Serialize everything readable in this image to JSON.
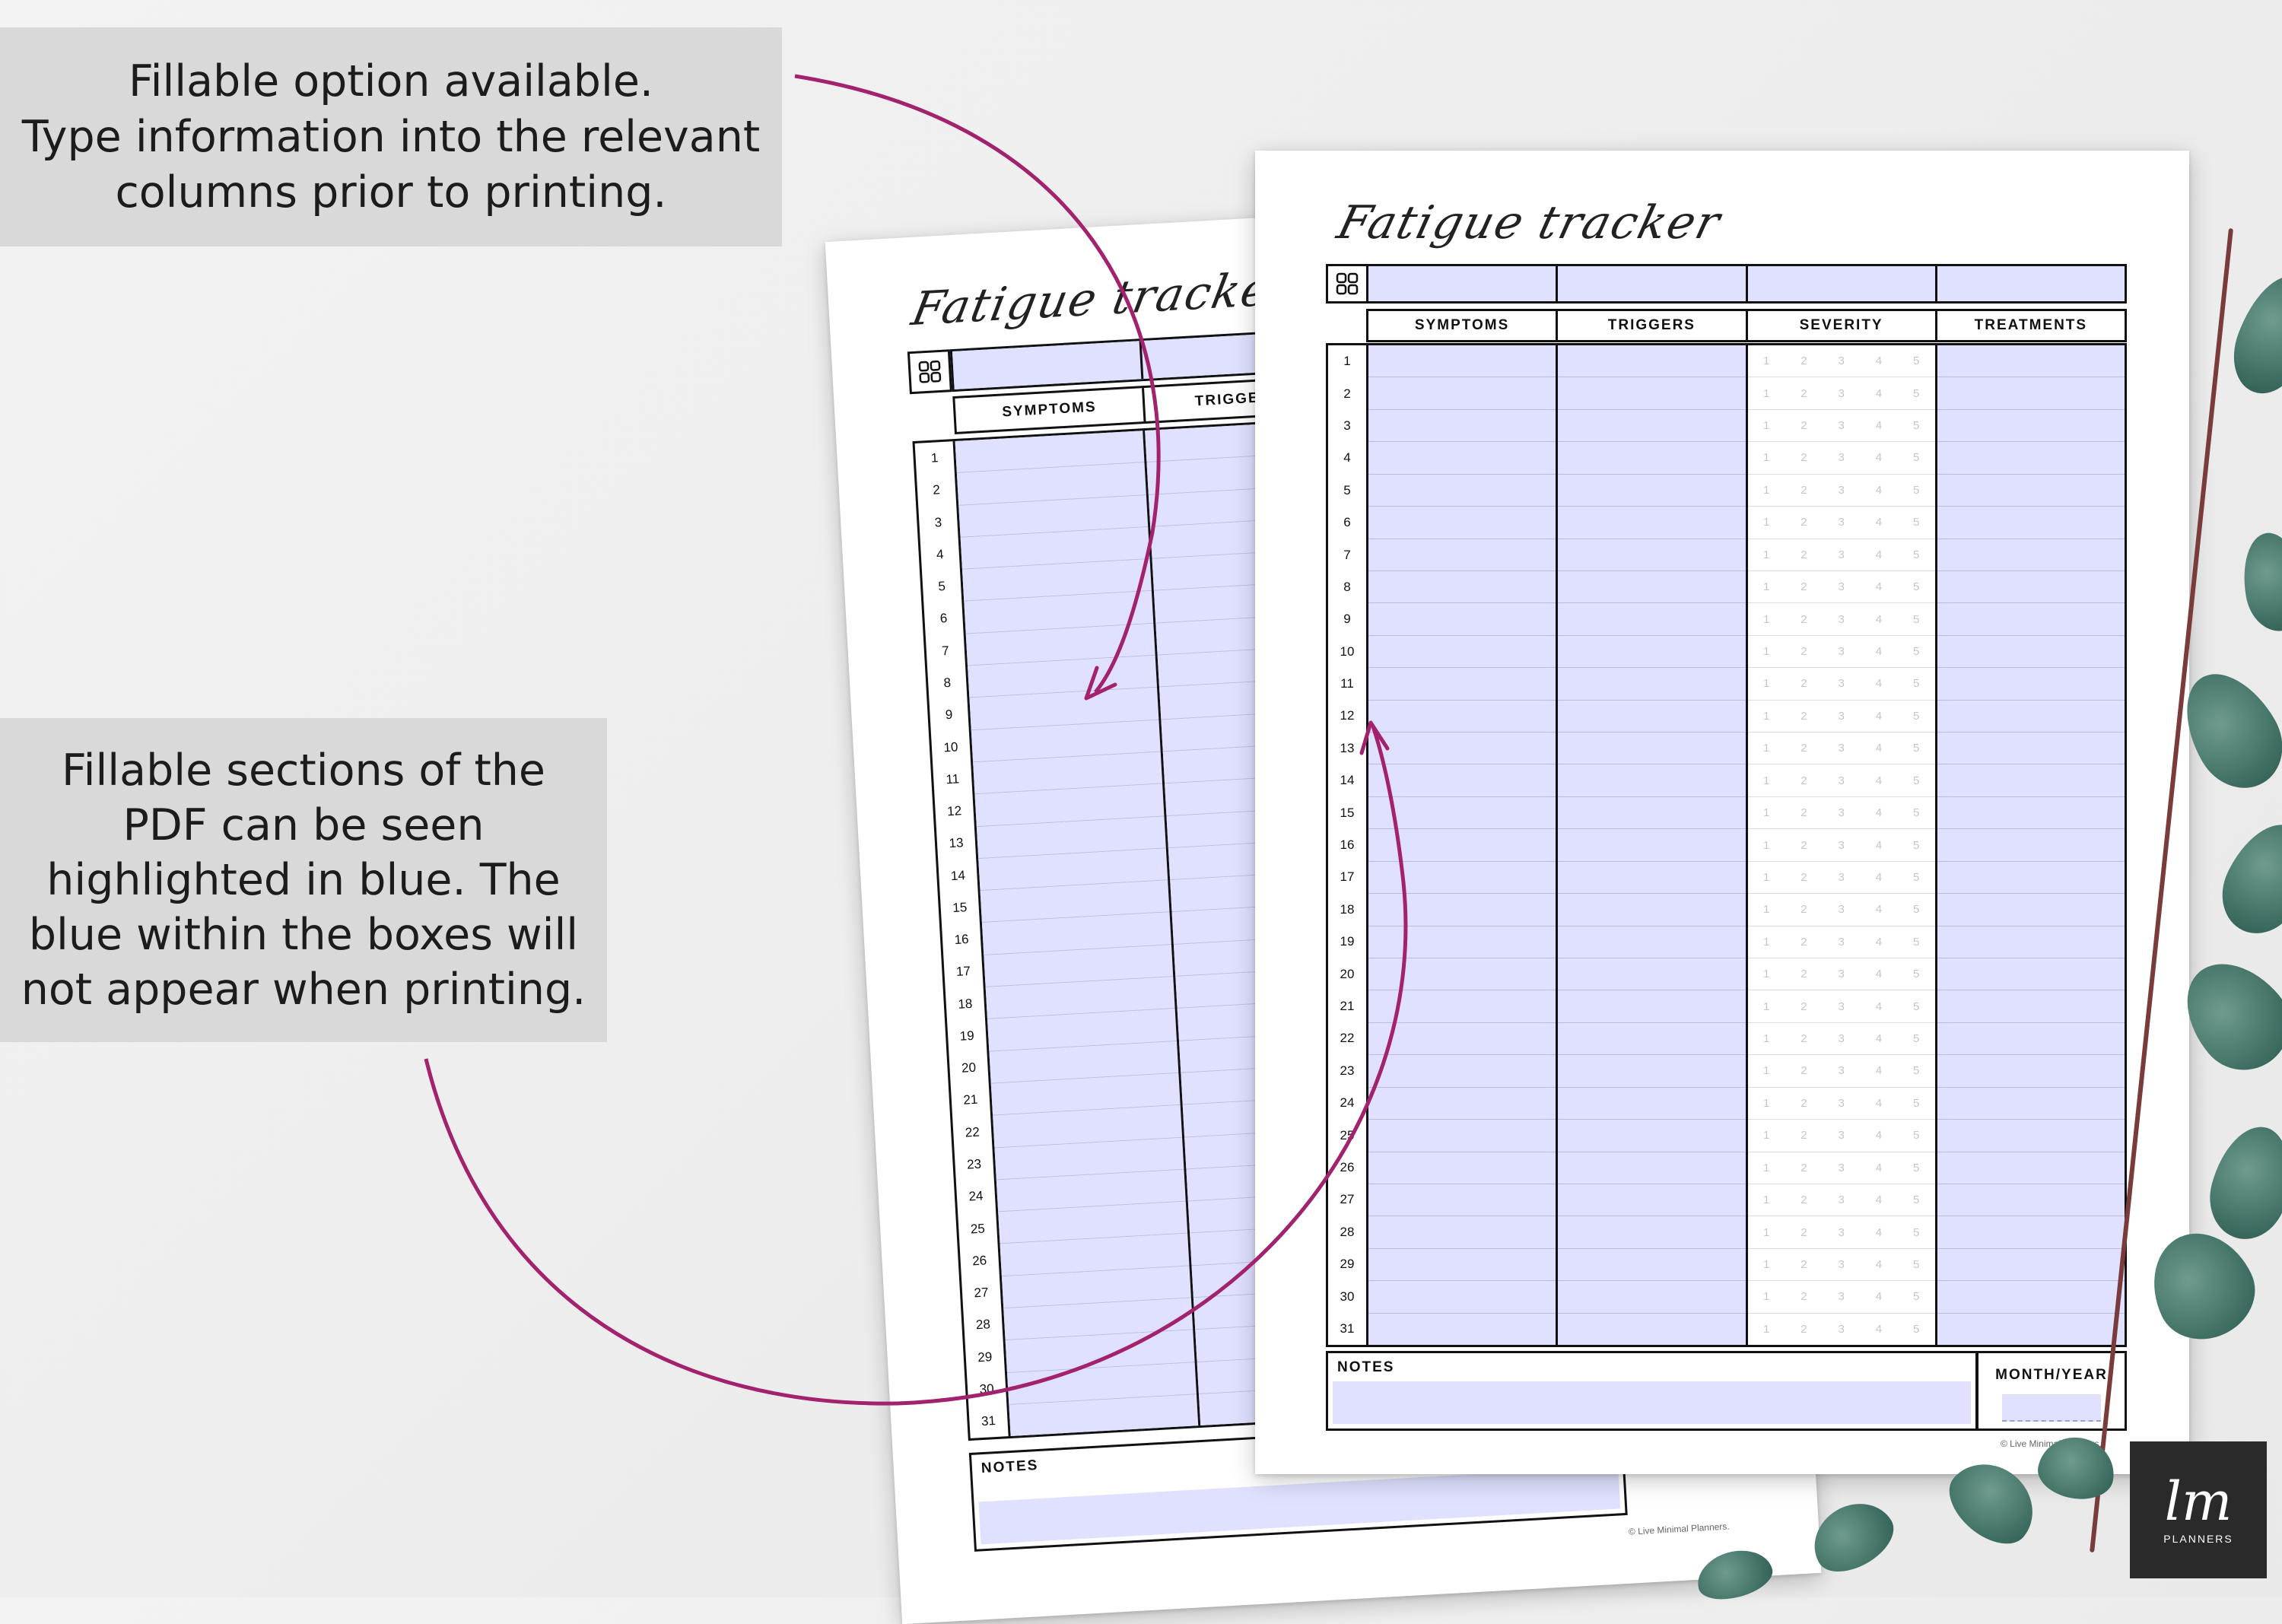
{
  "callouts": {
    "top": [
      "Fillable option available.",
      "Type information into the relevant",
      "columns prior to printing."
    ],
    "bottom": [
      "Fillable sections of the",
      "PDF can be seen",
      "highlighted in blue. The",
      "blue within the boxes will",
      "not appear when printing."
    ]
  },
  "tracker": {
    "title": "Fatigue tracker",
    "columns": [
      "SYMPTOMS",
      "TRIGGERS",
      "SEVERITY",
      "TREATMENTS"
    ],
    "row_numbers": [
      "1",
      "2",
      "3",
      "4",
      "5",
      "6",
      "7",
      "8",
      "9",
      "10",
      "11",
      "12",
      "13",
      "14",
      "15",
      "16",
      "17",
      "18",
      "19",
      "20",
      "21",
      "22",
      "23",
      "24",
      "25",
      "26",
      "27",
      "28",
      "29",
      "30",
      "31"
    ],
    "severity_scale": [
      "1",
      "2",
      "3",
      "4",
      "5"
    ],
    "notes_label": "NOTES",
    "month_year_label": "MONTH/YEAR",
    "copyright": "© Live Minimal Planners."
  },
  "logo": {
    "mark": "lm",
    "word": "PLANNERS"
  },
  "colors": {
    "fillable_blue": "#dfe1ff",
    "arrow": "#a3226e",
    "callout_bg": "#d9d9d9"
  }
}
